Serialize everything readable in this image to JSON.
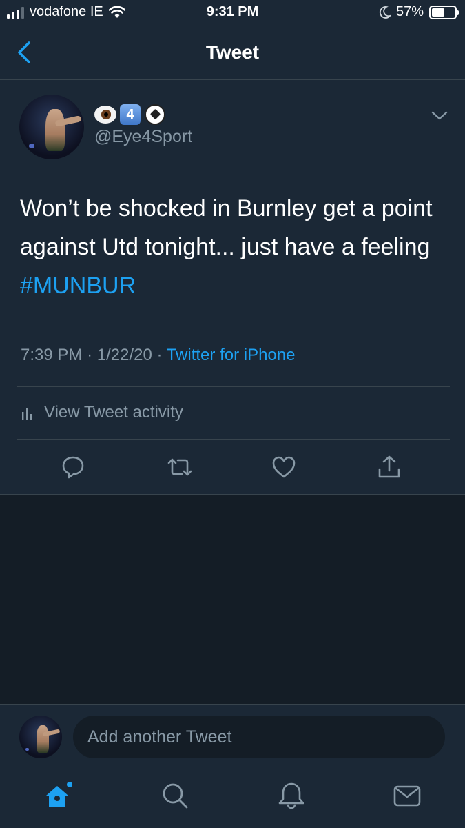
{
  "status_bar": {
    "carrier": "vodafone IE",
    "time": "9:31 PM",
    "battery": "57%",
    "battery_level": 0.57
  },
  "nav": {
    "title": "Tweet"
  },
  "tweet": {
    "display_name_emojis": [
      "eye-emoji",
      "keycap-4-emoji",
      "soccer-ball-emoji"
    ],
    "keycap_digit": "4",
    "handle": "@Eye4Sport",
    "text_plain": "Won’t be shocked in Burnley get a point against Utd tonight... just have a feeling ",
    "hashtag": "#MUNBUR",
    "time": "7:39 PM",
    "date": "1/22/20",
    "separator": "·",
    "source": "Twitter for iPhone",
    "activity_label": "View Tweet activity"
  },
  "actions": [
    "reply-icon",
    "retweet-icon",
    "like-icon",
    "share-icon"
  ],
  "reply": {
    "placeholder": "Add another Tweet"
  },
  "tab_bar": [
    "home-icon",
    "search-icon",
    "notifications-icon",
    "messages-icon"
  ],
  "colors": {
    "background": "#141d26",
    "surface": "#1b2836",
    "accent": "#1da1f2",
    "secondary_text": "#8899a6",
    "border": "#38444d"
  }
}
